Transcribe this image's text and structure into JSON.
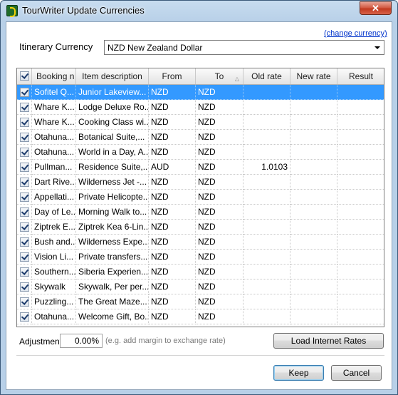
{
  "window": {
    "title": "TourWriter Update Currencies",
    "close_label": "✕"
  },
  "change_currency_link": "(change currency)",
  "itinerary_currency": {
    "label": "Itinerary Currency",
    "value": "NZD New Zealand Dollar"
  },
  "table": {
    "columns": [
      "Booking n",
      "Item description",
      "From",
      "To",
      "Old rate",
      "New rate",
      "Result"
    ],
    "rows": [
      {
        "booking": "Sofitel Q...",
        "item": "Junior Lakeview...",
        "from": "NZD",
        "to": "NZD",
        "old_rate": "",
        "new_rate": "",
        "result": "",
        "selected": true
      },
      {
        "booking": "Whare K...",
        "item": "Lodge Deluxe Ro...",
        "from": "NZD",
        "to": "NZD",
        "old_rate": "",
        "new_rate": "",
        "result": ""
      },
      {
        "booking": "Whare K...",
        "item": "Cooking Class wi...",
        "from": "NZD",
        "to": "NZD",
        "old_rate": "",
        "new_rate": "",
        "result": ""
      },
      {
        "booking": "Otahuna...",
        "item": "Botanical Suite,...",
        "from": "NZD",
        "to": "NZD",
        "old_rate": "",
        "new_rate": "",
        "result": ""
      },
      {
        "booking": "Otahuna...",
        "item": "World in a Day, A...",
        "from": "NZD",
        "to": "NZD",
        "old_rate": "",
        "new_rate": "",
        "result": ""
      },
      {
        "booking": "Pullman...",
        "item": "Residence Suite,...",
        "from": "AUD",
        "to": "NZD",
        "old_rate": "1.0103",
        "new_rate": "",
        "result": ""
      },
      {
        "booking": "Dart Rive...",
        "item": "Wilderness Jet -...",
        "from": "NZD",
        "to": "NZD",
        "old_rate": "",
        "new_rate": "",
        "result": ""
      },
      {
        "booking": "Appellati...",
        "item": "Private Helicopte...",
        "from": "NZD",
        "to": "NZD",
        "old_rate": "",
        "new_rate": "",
        "result": ""
      },
      {
        "booking": "Day of Le...",
        "item": "Morning Walk to...",
        "from": "NZD",
        "to": "NZD",
        "old_rate": "",
        "new_rate": "",
        "result": ""
      },
      {
        "booking": "Ziptrek E...",
        "item": "Ziptrek Kea 6-Lin...",
        "from": "NZD",
        "to": "NZD",
        "old_rate": "",
        "new_rate": "",
        "result": ""
      },
      {
        "booking": "Bush and...",
        "item": "Wilderness Expe...",
        "from": "NZD",
        "to": "NZD",
        "old_rate": "",
        "new_rate": "",
        "result": ""
      },
      {
        "booking": "Vision Li...",
        "item": "Private transfers...",
        "from": "NZD",
        "to": "NZD",
        "old_rate": "",
        "new_rate": "",
        "result": ""
      },
      {
        "booking": "Southern...",
        "item": "Siberia Experien...",
        "from": "NZD",
        "to": "NZD",
        "old_rate": "",
        "new_rate": "",
        "result": ""
      },
      {
        "booking": "Skywalk",
        "item": "Skywalk, Per per...",
        "from": "NZD",
        "to": "NZD",
        "old_rate": "",
        "new_rate": "",
        "result": ""
      },
      {
        "booking": "Puzzling...",
        "item": "The Great Maze...",
        "from": "NZD",
        "to": "NZD",
        "old_rate": "",
        "new_rate": "",
        "result": ""
      },
      {
        "booking": "Otahuna...",
        "item": "Welcome Gift, Bo...",
        "from": "NZD",
        "to": "NZD",
        "old_rate": "",
        "new_rate": "",
        "result": ""
      }
    ]
  },
  "adjustment": {
    "label": "Adjustment",
    "value": "0.00%",
    "hint": "(e.g. add margin to exchange rate)"
  },
  "buttons": {
    "load_rates": "Load Internet Rates",
    "keep": "Keep",
    "cancel": "Cancel"
  },
  "colors": {
    "selection": "#3399ff",
    "link": "#0033cc",
    "title_bar": "#b8d0e8",
    "close_button": "#c23a20"
  }
}
